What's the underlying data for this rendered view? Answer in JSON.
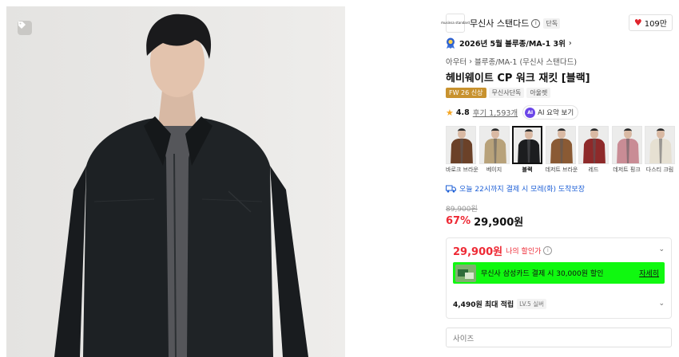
{
  "colors": {
    "accent_red": "#ee2a35",
    "promo_green": "#10f810",
    "badge_gold": "#c8922e",
    "link_blue": "#1d5fd6"
  },
  "brand": {
    "logo_text": "musinsa standard",
    "name": "무신사 스탠다드",
    "exclusive_badge": "단독"
  },
  "likes": {
    "count": "109만",
    "icon": "heart-icon"
  },
  "ranking": {
    "text": "2026년 5월 블루종/MA-1 3위",
    "arrow": "›"
  },
  "breadcrumb": {
    "category": "아우터",
    "sep": "›",
    "subcategory": "블루종/MA-1 (무신사 스탠다드)"
  },
  "product": {
    "title": "헤비웨이트 CP 워크 재킷 [블랙]"
  },
  "badges": [
    "FW 26 신상",
    "무신사단독",
    "아울렛"
  ],
  "rating": {
    "score": "4.8",
    "reviews": "후기 1,593개",
    "ai_icon_text": "AI",
    "ai_label": "AI 요약 보기"
  },
  "color_options": [
    {
      "label": "바로크 브라운",
      "color": "#6b4128",
      "selected": false
    },
    {
      "label": "베이지",
      "color": "#b8a27a",
      "selected": false
    },
    {
      "label": "블랙",
      "color": "#1c1d1f",
      "selected": true
    },
    {
      "label": "데저트 브라운",
      "color": "#8a5a34",
      "selected": false
    },
    {
      "label": "레드",
      "color": "#8e2a2a",
      "selected": false
    },
    {
      "label": "데저트 핑크",
      "color": "#c98c95",
      "selected": false
    },
    {
      "label": "다스티 크림",
      "color": "#e6e0d2",
      "selected": false
    }
  ],
  "delivery": {
    "text": "오늘 22시까지 결제 시 모레(화) 도착보장"
  },
  "price": {
    "original": "89,900원",
    "discount": "67%",
    "final": "29,900원"
  },
  "my_price": {
    "amount": "29,900원",
    "label": "나의 할인가"
  },
  "promo": {
    "text": "무신사 삼성카드 결제 시 30,000원 할인",
    "more": "자세히"
  },
  "points": {
    "text": "4,490원 최대 적립",
    "level": "LV.5 실버"
  },
  "size_select": {
    "placeholder": "사이즈"
  }
}
